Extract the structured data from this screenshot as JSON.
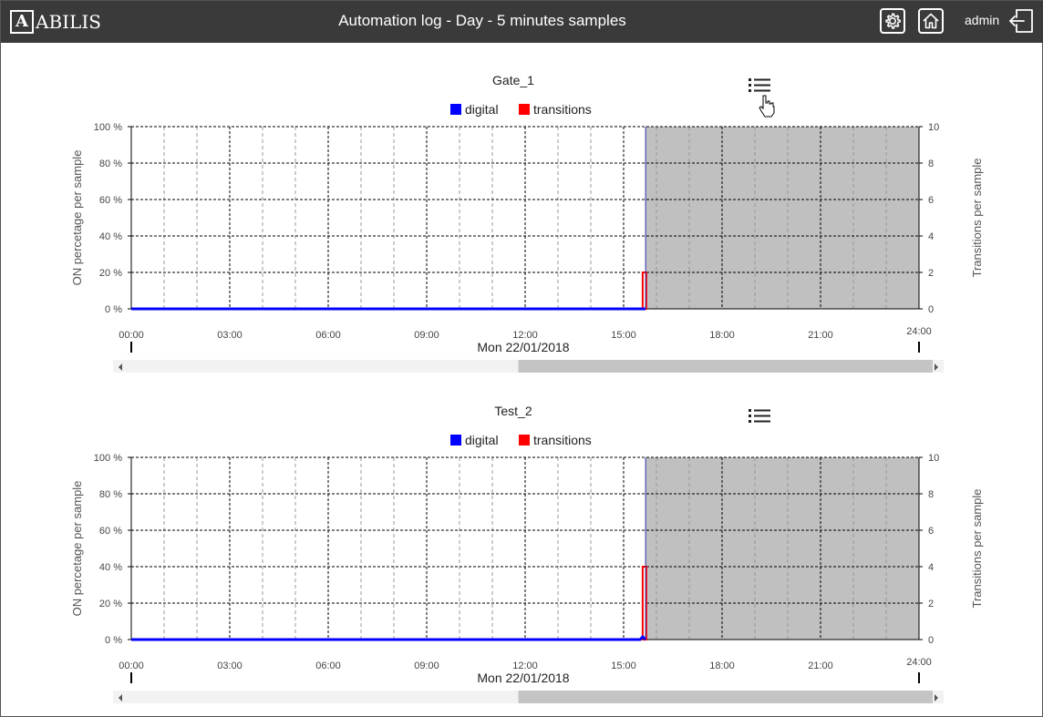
{
  "header": {
    "logo_text": "ABILIS",
    "logo_mark": "A",
    "title": "Automation log - Day - 5 minutes samples",
    "user": "admin",
    "icons": [
      "gear-icon",
      "home-icon",
      "logout-icon"
    ]
  },
  "chart_data": [
    {
      "type": "bar",
      "title": "Gate_1",
      "legend": [
        "digital",
        "transitions"
      ],
      "legend_position": "top-center",
      "colors": {
        "digital": "#0000ff",
        "transitions": "#ff0000",
        "future_shading": "#c0c0c0"
      },
      "x_ticks": [
        "00:00",
        "03:00",
        "06:00",
        "09:00",
        "12:00",
        "15:00",
        "18:00",
        "21:00",
        "24:00"
      ],
      "xlabel": "Mon 22/01/2018",
      "ylabel_left": "ON percetage per sample",
      "ylabel_right": "Transitions per sample",
      "y_ticks_left": [
        "0 %",
        "20 %",
        "40 %",
        "60 %",
        "80 %",
        "100 %"
      ],
      "y_ticks_right": [
        "0",
        "2",
        "4",
        "6",
        "8",
        "10"
      ],
      "ylim_left": [
        0,
        100
      ],
      "ylim_right": [
        0,
        10
      ],
      "xlim_hours": [
        0,
        24
      ],
      "now_hour": 15.67,
      "grid": true,
      "series": [
        {
          "name": "digital",
          "x_hours": [
            0,
            15.67
          ],
          "values": [
            0,
            0
          ]
        },
        {
          "name": "transitions",
          "x_hours": [
            15.58
          ],
          "values": [
            2
          ]
        }
      ],
      "scroll_position": 0.5
    },
    {
      "type": "bar",
      "title": "Test_2",
      "legend": [
        "digital",
        "transitions"
      ],
      "legend_position": "top-center",
      "colors": {
        "digital": "#0000ff",
        "transitions": "#ff0000",
        "future_shading": "#c0c0c0"
      },
      "x_ticks": [
        "00:00",
        "03:00",
        "06:00",
        "09:00",
        "12:00",
        "15:00",
        "18:00",
        "21:00",
        "24:00"
      ],
      "xlabel": "Mon 22/01/2018",
      "ylabel_left": "ON percetage per sample",
      "ylabel_right": "Transitions per sample",
      "y_ticks_left": [
        "0 %",
        "20 %",
        "40 %",
        "60 %",
        "80 %",
        "100 %"
      ],
      "y_ticks_right": [
        "0",
        "2",
        "4",
        "6",
        "8",
        "10"
      ],
      "ylim_left": [
        0,
        100
      ],
      "ylim_right": [
        0,
        10
      ],
      "xlim_hours": [
        0,
        24
      ],
      "now_hour": 15.67,
      "grid": true,
      "series": [
        {
          "name": "digital",
          "x_hours": [
            0,
            15.5,
            15.58,
            15.67
          ],
          "values": [
            0,
            0,
            1.5,
            0
          ]
        },
        {
          "name": "transitions",
          "x_hours": [
            15.58
          ],
          "values": [
            4
          ]
        }
      ],
      "scroll_position": 0.5
    }
  ]
}
